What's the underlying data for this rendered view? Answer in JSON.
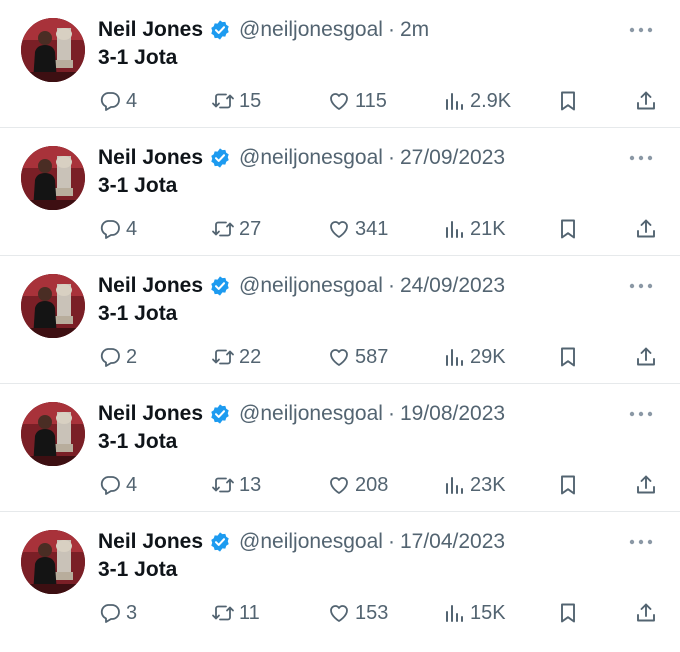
{
  "tweets": [
    {
      "name": "Neil Jones",
      "handle": "@neiljonesgoal",
      "separator": "·",
      "time": "2m",
      "text": "3-1 Jota",
      "replies": "4",
      "retweets": "15",
      "likes": "115",
      "views": "2.9K"
    },
    {
      "name": "Neil Jones",
      "handle": "@neiljonesgoal",
      "separator": "·",
      "time": "27/09/2023",
      "text": "3-1 Jota",
      "replies": "4",
      "retweets": "27",
      "likes": "341",
      "views": "21K"
    },
    {
      "name": "Neil Jones",
      "handle": "@neiljonesgoal",
      "separator": "·",
      "time": "24/09/2023",
      "text": "3-1 Jota",
      "replies": "2",
      "retweets": "22",
      "likes": "587",
      "views": "29K"
    },
    {
      "name": "Neil Jones",
      "handle": "@neiljonesgoal",
      "separator": "·",
      "time": "19/08/2023",
      "text": "3-1 Jota",
      "replies": "4",
      "retweets": "13",
      "likes": "208",
      "views": "23K"
    },
    {
      "name": "Neil Jones",
      "handle": "@neiljonesgoal",
      "separator": "·",
      "time": "17/04/2023",
      "text": "3-1 Jota",
      "replies": "3",
      "retweets": "11",
      "likes": "153",
      "views": "15K"
    }
  ],
  "icons": {
    "verified": "verified-badge-icon",
    "more": "more-options-icon",
    "reply": "reply-icon",
    "retweet": "retweet-icon",
    "like": "heart-icon",
    "views": "views-icon",
    "bookmark": "bookmark-icon",
    "share": "share-icon"
  },
  "colors": {
    "verified": "#1d9bf0",
    "secondary_text": "#536471",
    "primary_text": "#0f1419",
    "divider": "#e6e9eb"
  }
}
